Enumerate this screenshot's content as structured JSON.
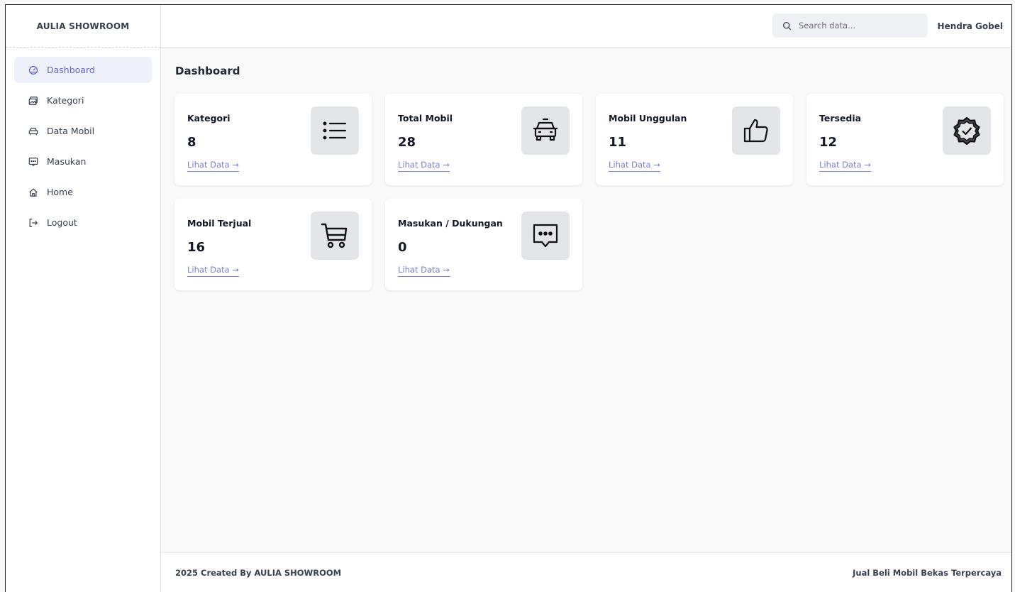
{
  "brand": "AULIA SHOWROOM",
  "sidebar": {
    "items": [
      {
        "label": "Dashboard",
        "icon": "gauge-icon",
        "active": true
      },
      {
        "label": "Kategori",
        "icon": "images-icon"
      },
      {
        "label": "Data Mobil",
        "icon": "car-icon"
      },
      {
        "label": "Masukan",
        "icon": "message-icon"
      },
      {
        "label": "Home",
        "icon": "home-icon"
      },
      {
        "label": "Logout",
        "icon": "logout-icon"
      }
    ]
  },
  "header": {
    "search_placeholder": "Search data...",
    "user_name": "Hendra Gobel"
  },
  "main": {
    "title": "Dashboard",
    "cards": [
      {
        "title": "Kategori",
        "value": "8",
        "link": "Lihat Data →",
        "icon": "list-icon"
      },
      {
        "title": "Total Mobil",
        "value": "28",
        "link": "Lihat Data →",
        "icon": "taxi-icon"
      },
      {
        "title": "Mobil Unggulan",
        "value": "11",
        "link": "Lihat Data →",
        "icon": "thumbs-up-icon"
      },
      {
        "title": "Tersedia",
        "value": "12",
        "link": "Lihat Data →",
        "icon": "badge-check-icon"
      },
      {
        "title": "Mobil Terjual",
        "value": "16",
        "link": "Lihat Data →",
        "icon": "cart-icon"
      },
      {
        "title": "Masukan / Dukungan",
        "value": "0",
        "link": "Lihat Data →",
        "icon": "chat-icon"
      }
    ]
  },
  "footer": {
    "left": "2025 Created By AULIA SHOWROOM",
    "right": "Jual Beli Mobil Bekas Terpercaya"
  },
  "colors": {
    "accent": "#6366d1",
    "active_bg": "#eef0fa",
    "link": "#7c7fd6",
    "icon_tile": "#e4e5e8"
  }
}
